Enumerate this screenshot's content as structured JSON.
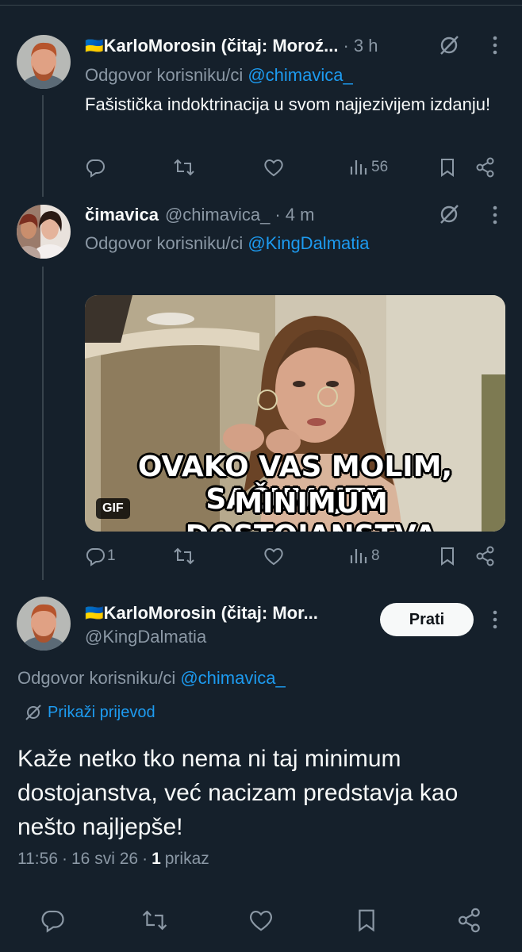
{
  "tweet1": {
    "flag": "🇺🇦",
    "name": "KarloMorosin (čitaj: Moroź...",
    "time": "· 3 h",
    "reply_label": "Odgovor korisniku/ci",
    "reply_handle": "@chimavica_",
    "text": "Fašistička indoktrinacija u svom najjezivijem izdanju!",
    "views": "56"
  },
  "tweet2": {
    "name": "čimavica",
    "handle": "@chimavica_",
    "time": "· 4 m",
    "reply_label": "Odgovor korisniku/ci",
    "reply_handle": "@KingDalmatia",
    "gif_caption_line1": "OVAKO VAS MOLIM, SAČUVAJTE",
    "gif_caption_line2": "MINIMUM DOSTOJANSTVA",
    "gif_badge": "GIF",
    "replies": "1",
    "views": "8"
  },
  "main_tweet": {
    "flag": "🇺🇦",
    "name": "KarloMorosin (čitaj: Mor...",
    "handle": "@KingDalmatia",
    "follow_label": "Prati",
    "reply_label": "Odgovor korisniku/ci",
    "reply_handle": "@chimavica_",
    "translate_label": "Prikaži prijevod",
    "text": "Kaže netko tko nema ni taj minimum dostojanstva, već nacizam predstavja kao nešto najljepše!",
    "time": "11:56",
    "date": "16 svi 26",
    "views_count": "1",
    "views_label": "prikaz"
  },
  "colors": {
    "background": "#15202b",
    "muted": "#8b98a5",
    "link": "#1d9bf0",
    "text": "#f7f9f9"
  }
}
